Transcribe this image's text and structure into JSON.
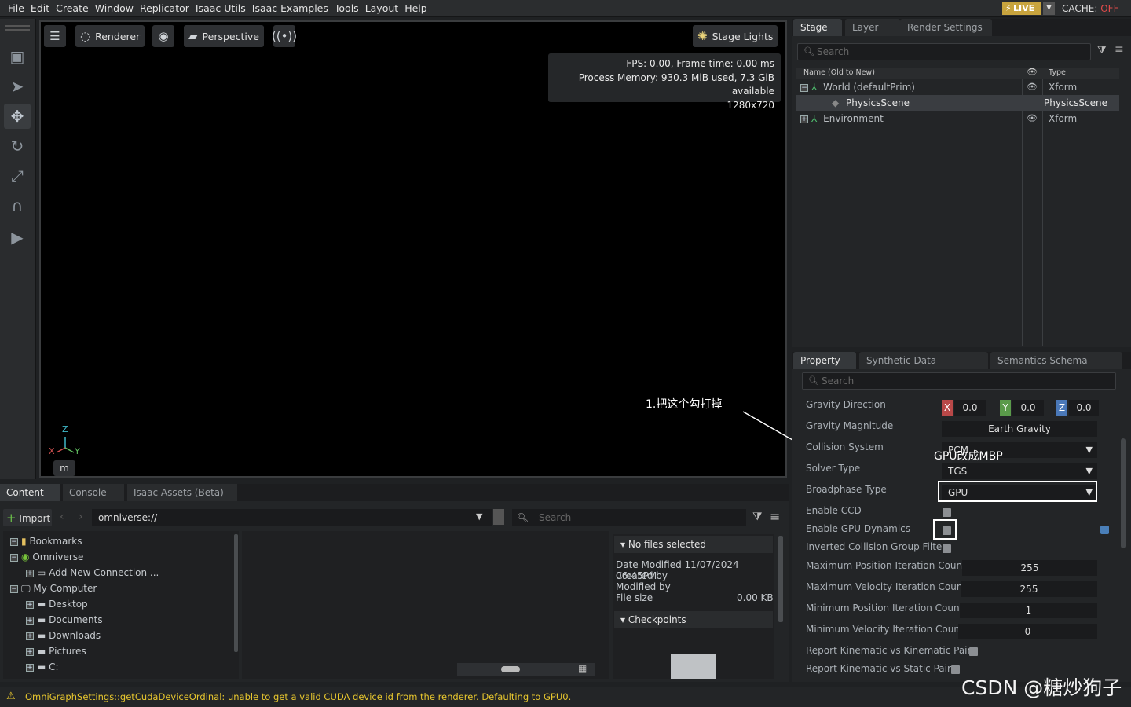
{
  "menu": [
    "File",
    "Edit",
    "Create",
    "Window",
    "Replicator",
    "Isaac Utils",
    "Isaac Examples",
    "Tools",
    "Layout",
    "Help"
  ],
  "live": {
    "label": "LIVE",
    "dropdown": "▼",
    "cache_label": "CACHE:",
    "cache_state": "OFF"
  },
  "viewport": {
    "renderer_label": "Renderer",
    "camera_label": "Perspective",
    "stage_lights_label": "Stage Lights",
    "stats": [
      "FPS: 0.00, Frame time: 0.00 ms",
      "Process Memory: 930.3 MiB used, 7.3 GiB available",
      "1280x720"
    ],
    "axis": {
      "z": "Z",
      "x": "X",
      "y": "Y"
    },
    "units_button": "m",
    "annotation": "1.把这个勾打掉"
  },
  "stage": {
    "tabs": [
      "Stage",
      "Layer",
      "Render Settings"
    ],
    "search_placeholder": "Search",
    "col_name": "Name (Old to New)",
    "col_type": "Type",
    "rows": [
      {
        "name": "World (defaultPrim)",
        "type": "Xform"
      },
      {
        "name": "PhysicsScene",
        "type": "PhysicsScene"
      },
      {
        "name": "Environment",
        "type": "Xform"
      }
    ]
  },
  "property": {
    "tabs": [
      "Property",
      "Synthetic Data Recorder",
      "Semantics Schema Editor"
    ],
    "search_placeholder": "Search",
    "gravity_direction": {
      "label": "Gravity Direction",
      "x": "0.0",
      "y": "0.0",
      "z": "0.0",
      "x_axis": "X",
      "y_axis": "Y",
      "z_axis": "Z"
    },
    "gravity_magnitude": {
      "label": "Gravity Magnitude",
      "value": "Earth Gravity"
    },
    "collision_system": {
      "label": "Collision System",
      "value": "PCM"
    },
    "solver_type": {
      "label": "Solver Type",
      "value": "TGS"
    },
    "broadphase_type": {
      "label": "Broadphase Type",
      "value": "GPU"
    },
    "enable_ccd": "Enable CCD",
    "enable_gpu_dynamics": "Enable GPU Dynamics",
    "inverted_filter": "Inverted Collision Group Filter",
    "max_pos_iter": {
      "label": "Maximum Position Iteration Count",
      "value": "255"
    },
    "max_vel_iter": {
      "label": "Maximum Velocity Iteration Count",
      "value": "255"
    },
    "min_pos_iter": {
      "label": "Minimum Position Iteration Count",
      "value": "1"
    },
    "min_vel_iter": {
      "label": "Minimum Velocity Iteration Count",
      "value": "0"
    },
    "report_kin_kin": "Report Kinematic vs Kinematic Pairs",
    "report_kin_static": "Report Kinematic vs Static Pairs",
    "annotation": "GPU改成MBP"
  },
  "content": {
    "tabs": [
      "Content",
      "Console",
      "Isaac Assets (Beta)"
    ],
    "import_label": "Import",
    "path": "omniverse://",
    "search_placeholder": "Search",
    "tree": [
      "Bookmarks",
      "Omniverse",
      "Add New Connection ...",
      "My Computer",
      "Desktop",
      "Documents",
      "Downloads",
      "Pictures",
      "C:"
    ],
    "details_header": "No files selected",
    "date_modified": "Date Modified 11/07/2024 06:45PM",
    "created_by": "Created by",
    "modified_by": "Modified by",
    "file_size_label": "File size",
    "file_size_value": "0.00 KB",
    "checkpoints": "Checkpoints"
  },
  "status": {
    "message": "OmniGraphSettings::getCudaDeviceOrdinal: unable to get a valid CUDA device id from the renderer. Defaulting to GPU0."
  },
  "watermark": "CSDN @糖炒狗子"
}
